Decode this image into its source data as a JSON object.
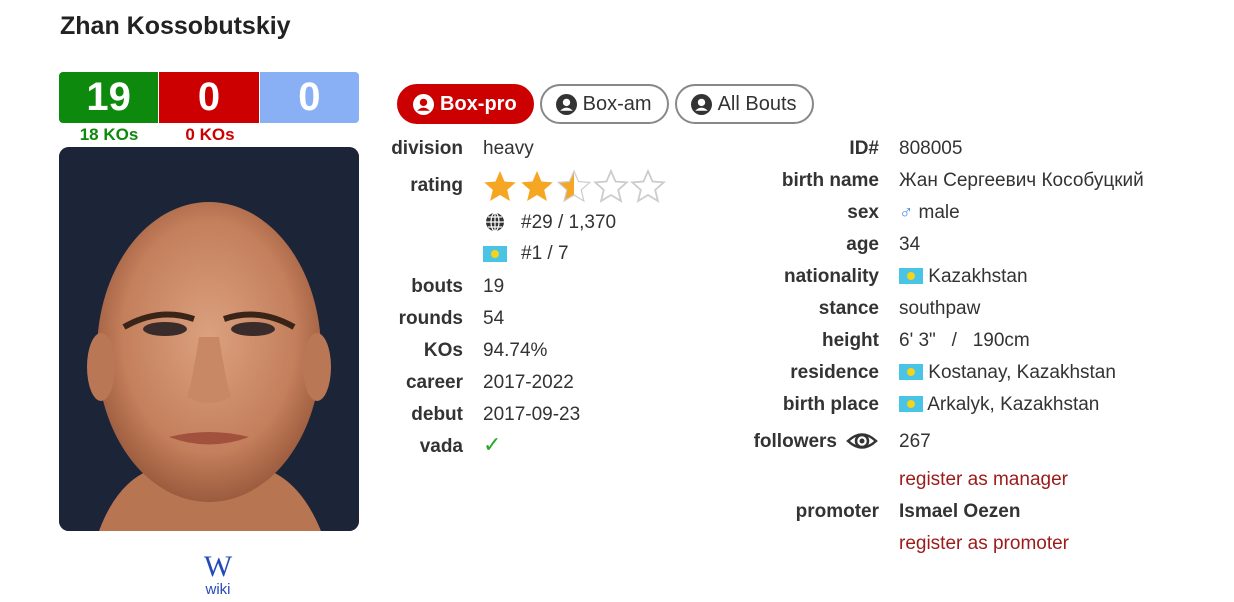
{
  "boxer": {
    "name": "Zhan Kossobutskiy"
  },
  "record": {
    "wins": "19",
    "losses": "0",
    "draws": "0",
    "wins_kos": "18 KOs",
    "losses_kos": "0 KOs"
  },
  "wiki": {
    "logo": "W",
    "label": "wiki"
  },
  "tabs": [
    {
      "label": "Box-pro",
      "active": true
    },
    {
      "label": "Box-am",
      "active": false
    },
    {
      "label": "All Bouts",
      "active": false
    }
  ],
  "left_details": {
    "division": {
      "label": "division",
      "value": "heavy"
    },
    "rating": {
      "label": "rating",
      "stars": 2.5,
      "max_stars": 5,
      "world_rank": "#29 / 1,370",
      "country_rank": "#1 / 7"
    },
    "bouts": {
      "label": "bouts",
      "value": "19"
    },
    "rounds": {
      "label": "rounds",
      "value": "54"
    },
    "kos": {
      "label": "KOs",
      "value": "94.74%"
    },
    "career": {
      "label": "career",
      "value": "2017-2022"
    },
    "debut": {
      "label": "debut",
      "value": "2017-09-23"
    },
    "vada": {
      "label": "vada",
      "value": "✓"
    }
  },
  "right_details": {
    "id": {
      "label": "ID#",
      "value": "808005"
    },
    "birth_name": {
      "label": "birth name",
      "value": "Жан Сергеевич Кособуцкий"
    },
    "sex": {
      "label": "sex",
      "symbol": "♂",
      "value": "male"
    },
    "age": {
      "label": "age",
      "value": "34"
    },
    "nationality": {
      "label": "nationality",
      "value": "Kazakhstan"
    },
    "stance": {
      "label": "stance",
      "value": "southpaw"
    },
    "height": {
      "label": "height",
      "value": "6' 3\"   /   190cm"
    },
    "residence": {
      "label": "residence",
      "value": "Kostanay, Kazakhstan"
    },
    "birth_place": {
      "label": "birth place",
      "value": "Arkalyk, Kazakhstan"
    },
    "followers": {
      "label": "followers",
      "value": "267"
    },
    "register_manager": "register as manager",
    "promoter": {
      "label": "promoter",
      "value": "Ismael Oezen"
    },
    "register_promoter": "register as promoter"
  },
  "colors": {
    "win": "#0d8a0d",
    "loss": "#cc0000",
    "draw": "#89b0f5",
    "star": "#f5a623",
    "link": "#9c1a1a"
  }
}
